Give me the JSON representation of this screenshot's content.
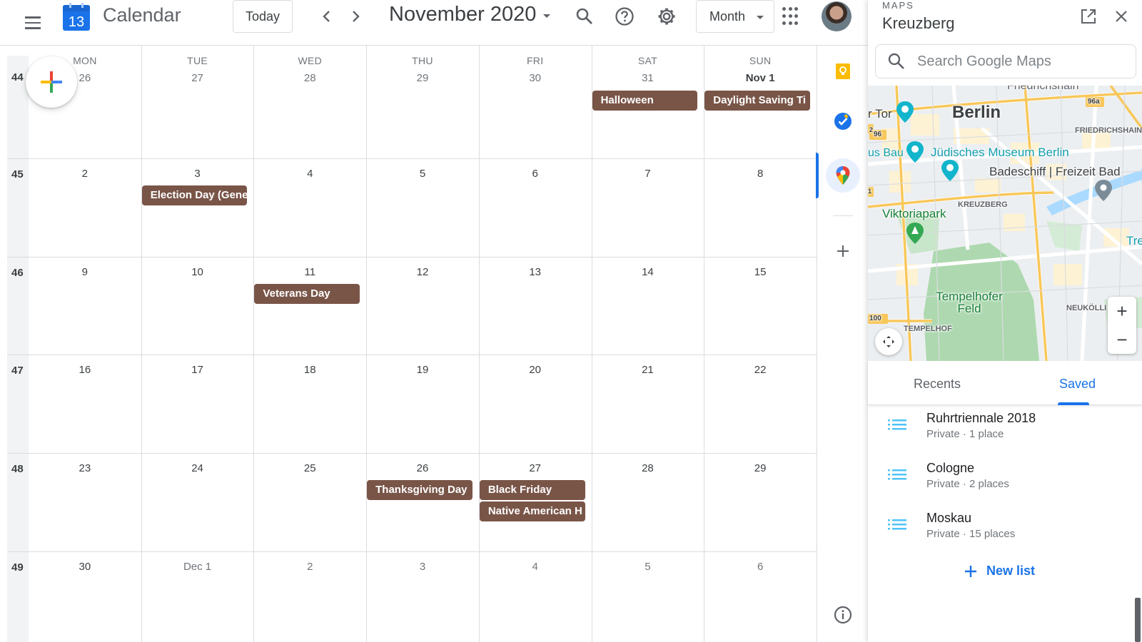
{
  "header": {
    "app_title": "Calendar",
    "logo_day": "13",
    "today_label": "Today",
    "month_title": "November 2020",
    "view_label": "Month"
  },
  "calendar": {
    "days_of_week": [
      "MON",
      "TUE",
      "WED",
      "THU",
      "FRI",
      "SAT",
      "SUN"
    ],
    "weeks": [
      {
        "week": "44",
        "days": [
          "26",
          "27",
          "28",
          "29",
          "30",
          "31",
          "Nov 1"
        ]
      },
      {
        "week": "45",
        "days": [
          "2",
          "3",
          "4",
          "5",
          "6",
          "7",
          "8"
        ]
      },
      {
        "week": "46",
        "days": [
          "9",
          "10",
          "11",
          "12",
          "13",
          "14",
          "15"
        ]
      },
      {
        "week": "47",
        "days": [
          "16",
          "17",
          "18",
          "19",
          "20",
          "21",
          "22"
        ]
      },
      {
        "week": "48",
        "days": [
          "23",
          "24",
          "25",
          "26",
          "27",
          "28",
          "29"
        ]
      },
      {
        "week": "49",
        "days": [
          "30",
          "Dec 1",
          "2",
          "3",
          "4",
          "5",
          "6"
        ]
      }
    ],
    "events": [
      {
        "title": "Halloween",
        "week": 0,
        "day": 5,
        "slot": 0
      },
      {
        "title": "Daylight Saving Ti",
        "week": 0,
        "day": 6,
        "slot": 0
      },
      {
        "title": "Election Day (Gene",
        "week": 1,
        "day": 1,
        "slot": 0
      },
      {
        "title": "Veterans Day",
        "week": 2,
        "day": 2,
        "slot": 0
      },
      {
        "title": "Thanksgiving Day",
        "week": 4,
        "day": 3,
        "slot": 0
      },
      {
        "title": "Black Friday",
        "week": 4,
        "day": 4,
        "slot": 0
      },
      {
        "title": "Native American H",
        "week": 4,
        "day": 4,
        "slot": 1
      }
    ],
    "event_color": "#795548"
  },
  "maps": {
    "kicker": "MAPS",
    "title": "Kreuzberg",
    "search_placeholder": "Search Google Maps",
    "map_labels": {
      "city": "Berlin",
      "museum": "Jüdisches Museum Berlin",
      "bath": "Badeschiff | Freizeit Bad",
      "park": "Viktoriapark",
      "district": "KREUZBERG",
      "field": "Tempelhofer Feld",
      "friedrichshain": "FRIEDRICHSHAIN",
      "neukolln": "NEUKÖLLI",
      "tempelhof": "TEMPELHOF",
      "top_partial": "Friedrichshain",
      "tor_partial": "r Tor",
      "bau_partial": "us Bau",
      "tre_partial": "Tre",
      "road_96a": "96a",
      "road_96": "96",
      "road_100": "100",
      "road_2": "2",
      "road_1": "1"
    },
    "tabs": [
      "Recents",
      "Saved"
    ],
    "active_tab": "Saved",
    "saved_lists": [
      {
        "name": "Ruhrtriennale 2018",
        "meta": "Private · 1 place"
      },
      {
        "name": "Cologne",
        "meta": "Private · 2 places"
      },
      {
        "name": "Moskau",
        "meta": "Private · 15 places"
      }
    ],
    "new_list_label": "New list",
    "zoom_in": "+",
    "zoom_out": "−"
  },
  "colors": {
    "accent": "#1a73e8",
    "event": "#795548",
    "keep": "#fbbc04",
    "tasks": "#1a73e8"
  }
}
